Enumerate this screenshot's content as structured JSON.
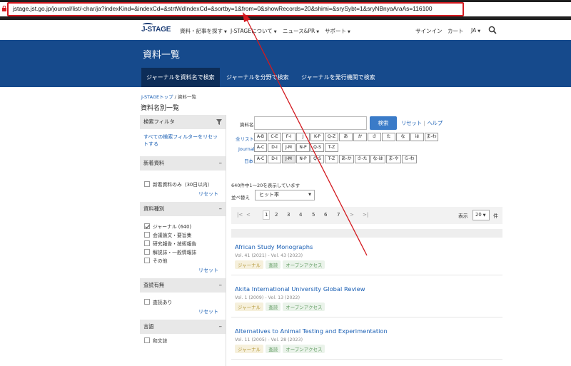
{
  "browser": {
    "url": "jstage.jst.go.jp/journal/list/-char/ja?indexKind=&indexCd=&strtWdIndexCd=&sortby=1&from=0&showRecords=20&shimi=&srySybt=1&sryNBnyaAraAs=116100"
  },
  "header": {
    "logo": "J-STAGE",
    "nav": [
      "資料・記事を探す",
      "J-STAGEについて",
      "ニュース&PR",
      "サポート"
    ],
    "signin": "サインイン",
    "cart": "カート",
    "lang": "JA"
  },
  "banner": {
    "title": "資料一覧",
    "tabs": [
      "ジャーナルを資料名で検索",
      "ジャーナルを分野で検索",
      "ジャーナルを発行機関で検索"
    ]
  },
  "breadcrumb": {
    "home": "J-STAGEトップ",
    "sep": " / ",
    "current": "資料一覧"
  },
  "page_heading": "資料名別一覧",
  "sidebar": {
    "filter_title": "検索フィルタ",
    "reset_all": "すべての検索フィルターをリセットする",
    "sections": [
      {
        "title": "新着資料",
        "items": [
          {
            "label": "新着資料のみ（30日以内）",
            "checked": false
          }
        ],
        "reset": "リセット"
      },
      {
        "title": "資料種別",
        "items": [
          {
            "label": "ジャーナル (640)",
            "checked": true
          },
          {
            "label": "会議論文・要旨集",
            "checked": false
          },
          {
            "label": "研究報告・技術報告",
            "checked": false
          },
          {
            "label": "解説誌・一般情報誌",
            "checked": false
          },
          {
            "label": "その他",
            "checked": false
          }
        ],
        "reset": "リセット"
      },
      {
        "title": "査読有無",
        "items": [
          {
            "label": "査読あり",
            "checked": false
          }
        ],
        "reset": "リセット"
      },
      {
        "title": "言語",
        "items": [
          {
            "label": "和文誌",
            "checked": false
          }
        ],
        "reset": ""
      }
    ]
  },
  "search": {
    "label": "資料名",
    "button": "検索",
    "reset": "リセット",
    "pipe": "|",
    "help": "ヘルプ"
  },
  "index": {
    "all_label": "全リスト",
    "journal_label": "Journal",
    "japan_label": "日本",
    "row_all": [
      "A-B",
      "C-E",
      "F-I",
      "J",
      "K-P",
      "Q-Z",
      "あ",
      "か",
      "さ",
      "た",
      "な",
      "は",
      "ま-わ"
    ],
    "row_journal": [
      "A-C",
      "D-I",
      "J-M",
      "N-P",
      "Q-S",
      "T-Z"
    ],
    "row_japan": [
      "A-C",
      "D-I",
      "J-M",
      "N-P",
      "Q-S",
      "T-Z",
      "あ-か",
      "さ-た",
      "な-は",
      "ま-や",
      "ら-わ"
    ]
  },
  "results": {
    "count_text": "640件中1～20を表示しています",
    "sort_label": "並べ替え",
    "sort_value": "ヒット率",
    "pages": [
      "|<",
      "<",
      "1",
      "2",
      "3",
      "4",
      "5",
      "6",
      "7",
      ">",
      ">|"
    ],
    "current_page": "1",
    "per_page_label": "表示",
    "per_page_value": "20",
    "per_page_unit": "件"
  },
  "articles": [
    {
      "title": "African Study Monographs",
      "vol": "Vol. 41 (2021) - Vol. 43 (2023)",
      "tags": [
        "ジャーナル",
        "査読",
        "オープンアクセス"
      ]
    },
    {
      "title": "Akita International University Global Review",
      "vol": "Vol. 1 (2009) - Vol. 13 (2022)",
      "tags": [
        "ジャーナル",
        "査読",
        "オープンアクセス"
      ]
    },
    {
      "title": "Alternatives to Animal Testing and Experimentation",
      "vol": "Vol. 11 (2005) - Vol. 28 (2023)",
      "tags": [
        "ジャーナル",
        "査読",
        "オープンアクセス"
      ]
    }
  ],
  "colors": {
    "banner": "#164a8c",
    "tab_active": "#0d2d58",
    "link": "#1a5fb4",
    "annotation": "#d3191f"
  }
}
